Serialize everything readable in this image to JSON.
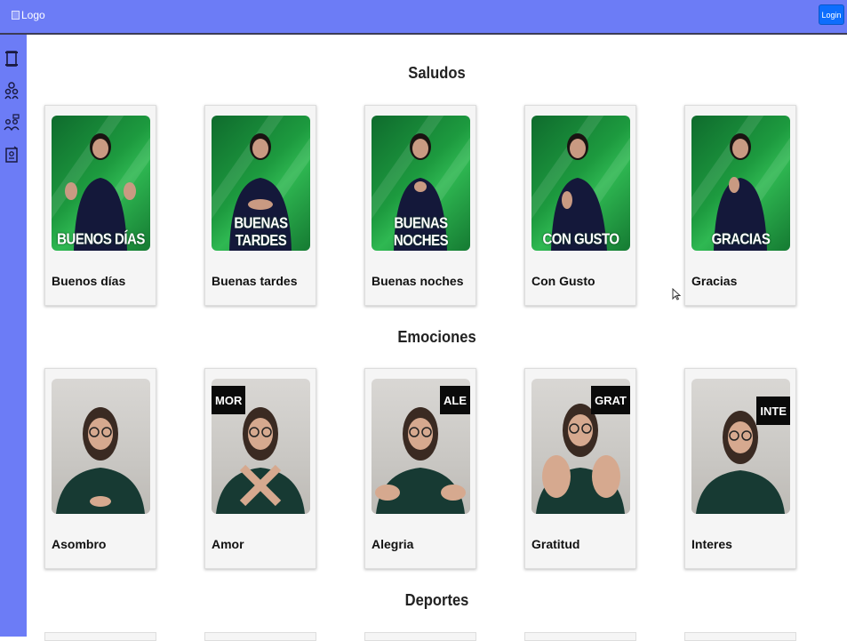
{
  "header": {
    "logo_alt": "Logo",
    "login_label": "Login"
  },
  "sidebar": {
    "items": [
      {
        "icon": "scroll-icon"
      },
      {
        "icon": "people-icon"
      },
      {
        "icon": "people-chat-icon"
      },
      {
        "icon": "id-card-icon"
      }
    ]
  },
  "sections": [
    {
      "title": "Saludos",
      "cards": [
        {
          "title": "Buenos días",
          "overlay": "BUENOS DÍAS"
        },
        {
          "title": "Buenas tardes",
          "overlay": "BUENAS TARDES"
        },
        {
          "title": "Buenas noches",
          "overlay": "BUENAS NOCHES"
        },
        {
          "title": "Con Gusto",
          "overlay": "CON GUSTO"
        },
        {
          "title": "Gracias",
          "overlay": "GRACIAS"
        }
      ]
    },
    {
      "title": "Emociones",
      "cards": [
        {
          "title": "Asombro",
          "tag": ""
        },
        {
          "title": "Amor",
          "tag": "MOR"
        },
        {
          "title": "Alegria",
          "tag": "ALE"
        },
        {
          "title": "Gratitud",
          "tag": "GRAT"
        },
        {
          "title": "Interes",
          "tag": "INTE"
        }
      ]
    },
    {
      "title": "Deportes",
      "cards": []
    }
  ]
}
